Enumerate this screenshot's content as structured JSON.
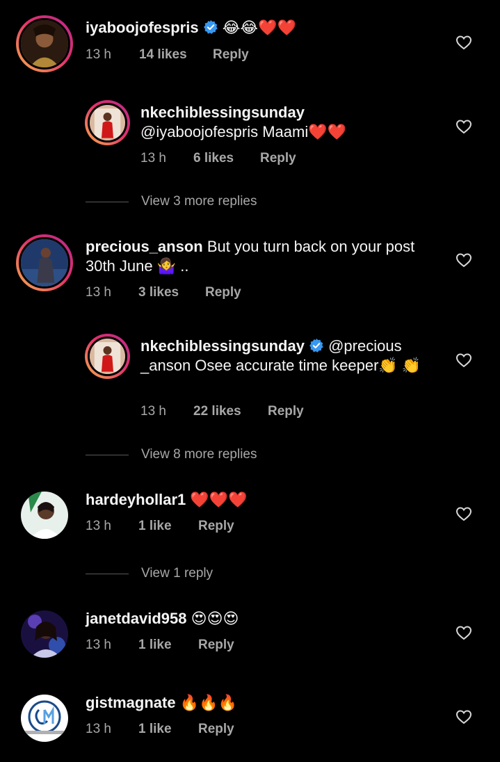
{
  "comments": [
    {
      "username": "iyaboojofespris",
      "verified": true,
      "text": " 😂😂❤️❤️",
      "time": "13 h",
      "likes": "14 likes",
      "reply": "Reply"
    },
    {
      "username": "nkechiblessingsunday",
      "verified": false,
      "text": "@iyaboojofespris Maami❤️❤️",
      "time": "13 h",
      "likes": "6 likes",
      "reply": "Reply"
    },
    {
      "username": "precious_anson",
      "verified": false,
      "text": " But you turn back on your post 30th June 🤷‍♀️ ..",
      "time": "13 h",
      "likes": "3 likes",
      "reply": "Reply"
    },
    {
      "username": "nkechiblessingsunday",
      "verified": true,
      "text": " @precious _anson Osee accurate time keeper👏 👏",
      "time": "13 h",
      "likes": "22 likes",
      "reply": "Reply"
    },
    {
      "username": "hardeyhollar1",
      "verified": false,
      "text": " ❤️❤️❤️",
      "time": "13 h",
      "likes": "1 like",
      "reply": "Reply"
    },
    {
      "username": "janetdavid958",
      "verified": false,
      "text": " 😍😍😍",
      "time": "13 h",
      "likes": "1 like",
      "reply": "Reply"
    },
    {
      "username": "gistmagnate",
      "verified": false,
      "text": " 🔥🔥🔥",
      "time": "13 h",
      "likes": "1 like",
      "reply": "Reply"
    }
  ],
  "view_more": [
    "View 3 more replies",
    "View 8 more replies",
    "View 1 reply"
  ],
  "icons": {
    "like": "heart-outline-icon",
    "verified": "verified-badge-icon"
  },
  "colors": {
    "background": "#000000",
    "text": "#f5f5f5",
    "secondary": "#a8a8a8",
    "verified": "#3897f0"
  }
}
